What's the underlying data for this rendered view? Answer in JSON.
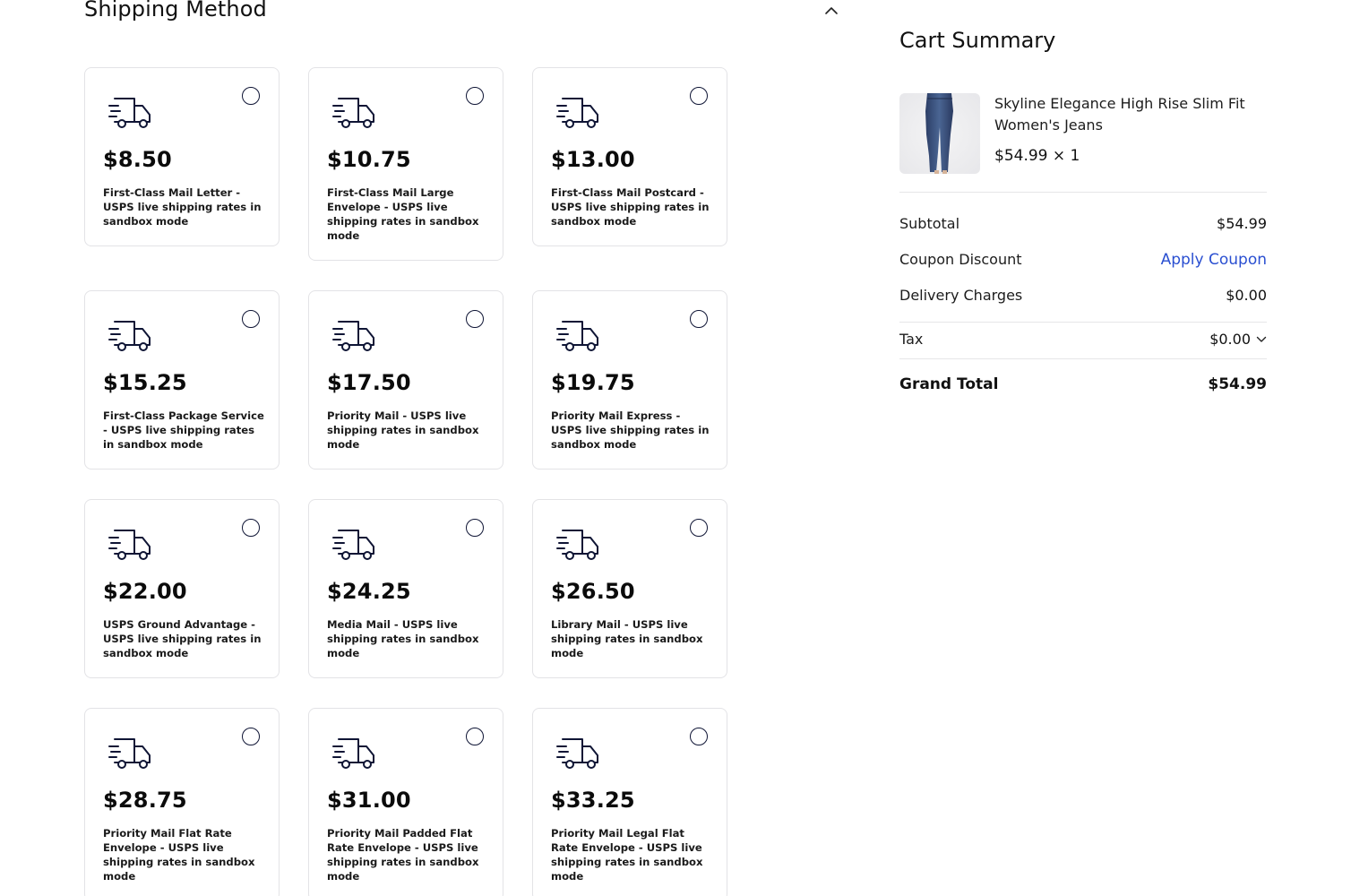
{
  "shipping": {
    "title": "Shipping Method",
    "collapse_icon": "chevron-up-icon",
    "options": [
      {
        "price": "$8.50",
        "desc": "First-Class Mail Letter - USPS live shipping rates in sandbox mode",
        "icon": "truck-icon"
      },
      {
        "price": "$10.75",
        "desc": "First-Class Mail Large Envelope - USPS live shipping rates in sandbox mode",
        "icon": "truck-icon"
      },
      {
        "price": "$13.00",
        "desc": "First-Class Mail Postcard - USPS live shipping rates in sandbox mode",
        "icon": "truck-icon"
      },
      {
        "price": "$15.25",
        "desc": "First-Class Package Service - USPS live shipping rates in sandbox mode",
        "icon": "truck-icon"
      },
      {
        "price": "$17.50",
        "desc": "Priority Mail - USPS live shipping rates in sandbox mode",
        "icon": "truck-icon"
      },
      {
        "price": "$19.75",
        "desc": "Priority Mail Express - USPS live shipping rates in sandbox mode",
        "icon": "truck-icon"
      },
      {
        "price": "$22.00",
        "desc": "USPS Ground Advantage - USPS live shipping rates in sandbox mode",
        "icon": "truck-icon"
      },
      {
        "price": "$24.25",
        "desc": "Media Mail - USPS live shipping rates in sandbox mode",
        "icon": "truck-icon"
      },
      {
        "price": "$26.50",
        "desc": "Library Mail - USPS live shipping rates in sandbox mode",
        "icon": "truck-icon"
      },
      {
        "price": "$28.75",
        "desc": "Priority Mail Flat Rate Envelope - USPS live shipping rates in sandbox mode",
        "icon": "truck-icon"
      },
      {
        "price": "$31.00",
        "desc": "Priority Mail Padded Flat Rate Envelope - USPS live shipping rates in sandbox mode",
        "icon": "truck-icon"
      },
      {
        "price": "$33.25",
        "desc": "Priority Mail Legal Flat Rate Envelope - USPS live shipping rates in sandbox mode",
        "icon": "truck-icon"
      }
    ]
  },
  "cart": {
    "title": "Cart Summary",
    "product": {
      "name": "Skyline Elegance High Rise Slim Fit Women's Jeans",
      "price_qty": "$54.99 × 1",
      "image": "jeans-product-image"
    },
    "subtotal_label": "Subtotal",
    "subtotal_value": "$54.99",
    "coupon_label": "Coupon Discount",
    "coupon_action": "Apply Coupon",
    "delivery_label": "Delivery Charges",
    "delivery_value": "$0.00",
    "tax_label": "Tax",
    "tax_value": "$0.00",
    "tax_icon": "chevron-down-icon",
    "grand_total_label": "Grand Total",
    "grand_total_value": "$54.99"
  },
  "colors": {
    "accent_link": "#2a4fd1",
    "icon_navy": "#0f1535",
    "card_border": "#e3e3e6"
  }
}
